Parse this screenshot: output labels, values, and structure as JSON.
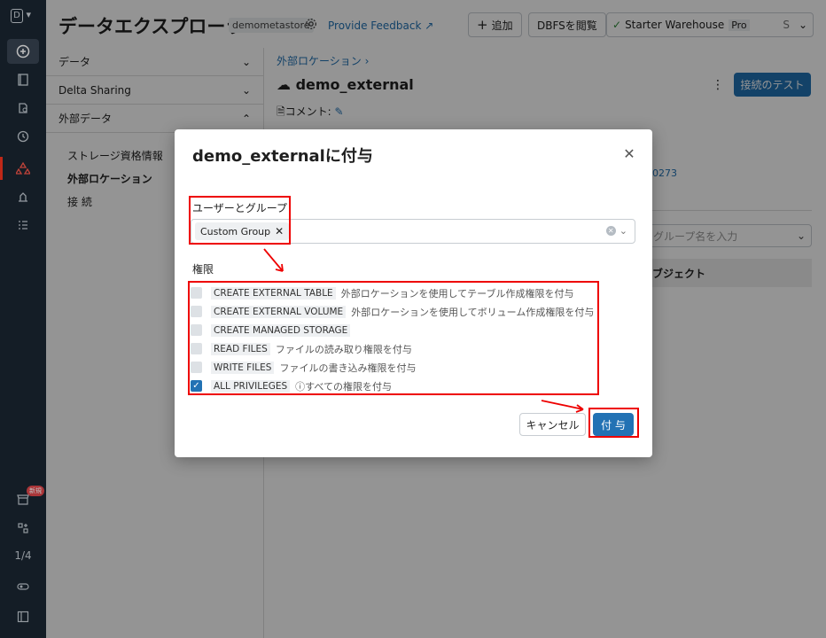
{
  "header": {
    "title": "データエクスプローラ",
    "metastore": "demometastore",
    "feedback": "Provide Feedback",
    "add_label": "追加",
    "dbfs_label": "DBFSを閲覧",
    "warehouse_name": "Starter Warehouse",
    "warehouse_tier": "Pro",
    "warehouse_size": "S"
  },
  "rail": {
    "badge": "新規",
    "page": "1/4"
  },
  "nav": {
    "sections": [
      "データ",
      "Delta Sharing",
      "外部データ"
    ],
    "subitems": [
      "ストレージ資格情報",
      "外部ロケーション",
      "接 続"
    ]
  },
  "main": {
    "breadcrumb": "外部ロケーション",
    "title": "demo_external",
    "test_button": "接続のテスト",
    "comment_label": "コメント:",
    "link_text": "0273",
    "search_placeholder": "グループ名を入力",
    "object_header": "ブジェクト"
  },
  "modal": {
    "title": "demo_externalに付与",
    "users_label": "ユーザーとグループ",
    "selected_chip": "Custom Group",
    "permissions_label": "権限",
    "permissions": [
      {
        "name": "CREATE EXTERNAL TABLE",
        "desc": "外部ロケーションを使用してテーブル作成権限を付与",
        "checked": false
      },
      {
        "name": "CREATE EXTERNAL VOLUME",
        "desc": "外部ロケーションを使用してボリューム作成権限を付与",
        "checked": false
      },
      {
        "name": "CREATE MANAGED STORAGE",
        "desc": "",
        "checked": false
      },
      {
        "name": "READ FILES",
        "desc": "ファイルの読み取り権限を付与",
        "checked": false
      },
      {
        "name": "WRITE FILES",
        "desc": "ファイルの書き込み権限を付与",
        "checked": false
      },
      {
        "name": "ALL PRIVILEGES",
        "desc": "ⓘすべての権限を付与",
        "checked": true
      }
    ],
    "cancel_label": "キャンセル",
    "grant_label": "付 与"
  },
  "colors": {
    "primary": "#2272b4",
    "rail": "#1b2733",
    "annotation": "#e00000"
  }
}
